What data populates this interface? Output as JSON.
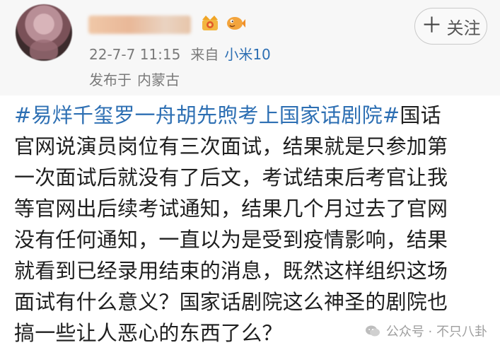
{
  "post": {
    "username": "██████",
    "date": "22-7-7 11:15",
    "source_label": "来自",
    "source_device": "小米10",
    "location_label": "发布于",
    "location": "内蒙古",
    "follow_button": "关注",
    "hashtag": "#易烊千玺罗一舟胡先煦考上国家话剧院#",
    "lines": {
      "l1_rest": "国话",
      "l2": "官网说演员岗位有三次面试，结果就是只参加第",
      "l3": "一次面试后就没有了后文，考试结束后考官让我",
      "l4": "等官网出后续考试通知，结果几个月过去了官网",
      "l5": "没有任何通知，一直以为是受到疫情影响，结果",
      "l6": "就看到已经录用结束的消息，既然这样组织这场",
      "l7": "面试有什么意义？国家话剧院这么神圣的剧院也",
      "l8": "搞一些让人恶心的东西了么？"
    }
  },
  "watermark": {
    "text": "公众号 · 不只八卦"
  },
  "icons": {
    "badge_crown": "crown-badge-icon",
    "badge_fish": "fish-badge-icon",
    "watermark_icon": "wechat-icon",
    "follow_plus": "plus-icon"
  },
  "colors": {
    "link_blue": "#2d6fb3",
    "meta_gray": "#7a7a7a"
  }
}
